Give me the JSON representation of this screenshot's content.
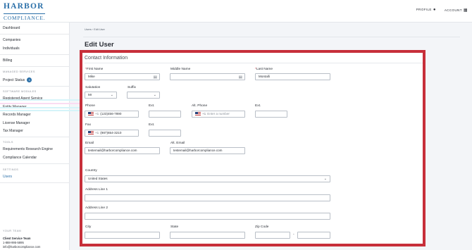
{
  "app": {
    "logo_top": "HARBOR",
    "logo_bottom": "COMPLIANCE.",
    "profile_label": "PROFILE",
    "account_label": "ACCOUNT"
  },
  "sidebar": {
    "dashboard": "Dashboard",
    "companies": "Companies",
    "individuals": "Individuals",
    "billing": "Billing",
    "managed_services_head": "MANAGED SERVICES",
    "project_status": "Project Status",
    "project_status_badge": "3",
    "software_modules_head": "SOFTWARE MODULES",
    "registered_agent": "Registered Agent Service",
    "entity_manager": "Entity Manager",
    "records_manager": "Records Manager",
    "license_manager": "License Manager",
    "tax_manager": "Tax Manager",
    "tools_head": "TOOLS",
    "requirements_engine": "Requirements Research Engine",
    "compliance_calendar": "Compliance Calendar",
    "settings_head": "SETTINGS",
    "users": "Users",
    "your_team_head": "YOUR TEAM",
    "team_name": "Client Service Team",
    "team_phone": "1-888-995-5895",
    "team_email": "info@harborcompliance.com"
  },
  "breadcrumb": "Users  ›  Edit User",
  "page_title": "Edit User",
  "form": {
    "section_title": "Contact Information",
    "first_name_label": "First Name",
    "first_name_value": "Mike",
    "middle_name_label": "Middle Name",
    "middle_name_value": "",
    "last_name_label": "Last Name",
    "last_name_value": "Montalli",
    "salutation_label": "Salutation",
    "salutation_value": "Mr",
    "suffix_label": "Suffix",
    "suffix_value": "",
    "phone_label": "Phone",
    "phone_code": "+1",
    "phone_value": "(123)456-7890",
    "phone_ext_label": "Ext.",
    "alt_phone_label": "Alt. Phone",
    "alt_phone_code": "+1",
    "alt_phone_placeholder": "Enter a number",
    "alt_phone_ext_label": "Ext.",
    "fax_label": "Fax",
    "fax_code": "+1",
    "fax_value": "(987)654-3210",
    "fax_ext_label": "Ext.",
    "email_label": "Email",
    "email_value": "testemail@harborcompliance.com",
    "alt_email_label": "Alt. Email",
    "alt_email_value": "testemail@harborcompliance.com",
    "country_label": "Country",
    "country_value": "United States",
    "address1_label": "Address Line 1",
    "address2_label": "Address Line 2",
    "city_label": "City",
    "state_label": "State",
    "zip_label": "Zip Code",
    "zip_dash": "-"
  },
  "colors": {
    "brand": "#2a6fa8",
    "highlight_border": "#c72f3a",
    "required": "#c72f3a"
  }
}
